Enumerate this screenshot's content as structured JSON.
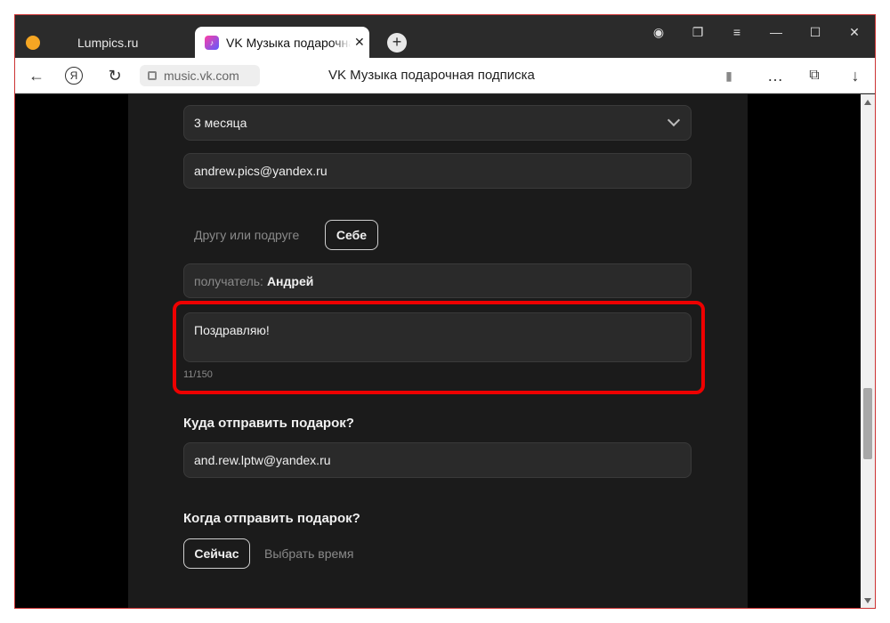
{
  "browser": {
    "tabs": [
      {
        "title": "Lumpics.ru",
        "active": false
      },
      {
        "title": "VK Музыка подарочная подписка",
        "active": true
      }
    ],
    "address": {
      "url": "music.vk.com"
    },
    "page_title": "VK Музыка подарочная подписка"
  },
  "icons": {
    "back": "←",
    "yandex": "Я",
    "reload": "↻",
    "bookmark": "▮",
    "menu_dots": "…",
    "downloads": "↓",
    "hamburger": "≡",
    "minimize": "—",
    "maximize": "☐",
    "close": "✕",
    "tab_close": "✕",
    "new_tab": "+"
  },
  "form": {
    "duration": "3 месяца",
    "sender_email": "andrew.pics@yandex.ru",
    "recipient_options": {
      "other": "Другу или подруге",
      "self": "Себе"
    },
    "recipient": {
      "label": "получатель:",
      "name": "Андрей"
    },
    "message": {
      "value": "Поздравляю!",
      "counter": "11/150"
    },
    "where_heading": "Куда отправить подарок?",
    "recipient_email": "and.rew.lptw@yandex.ru",
    "when_heading": "Когда отправить подарок?",
    "when_options": {
      "now": "Сейчас",
      "later": "Выбрать время"
    }
  },
  "colors": {
    "highlight": "#e00000",
    "panel": "#1b1b1b",
    "field": "#2a2a2a"
  }
}
